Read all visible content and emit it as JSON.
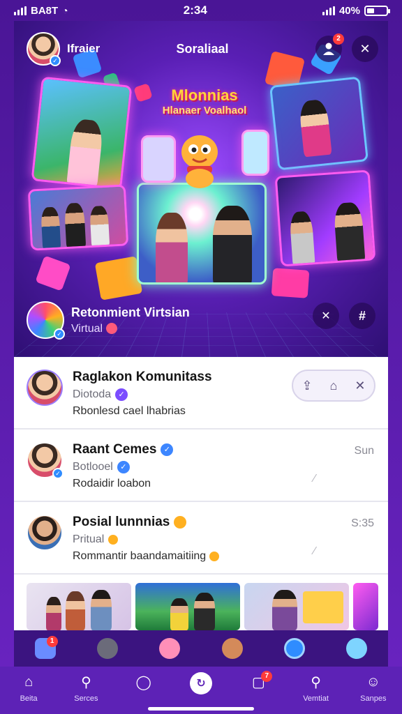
{
  "status_bar": {
    "carrier": "BA8T",
    "time": "2:34",
    "battery": "40%"
  },
  "hero": {
    "user_name": "Ifraier",
    "title": "Soraliaal",
    "neon_title_line1": "Mlonnias",
    "neon_title_line2": "Hlanaer Voalhaol",
    "notification_count": "2",
    "featured": {
      "title": "Retonmient Virtsian",
      "subtitle": "Virtual"
    }
  },
  "feed": {
    "items": [
      {
        "title": "Raglakon Komunitass",
        "subtitle": "Diotoda",
        "description": "Rbonlesd cael lhabrias",
        "meta": ""
      },
      {
        "title": "Raant Cemes",
        "subtitle": "Botlooel",
        "description": "Rodaidir loabon",
        "meta": "Sun"
      },
      {
        "title": "Posial lunnnias",
        "subtitle": "Pritual",
        "description": "Rommantir baandamaitiing",
        "meta": "S:35"
      }
    ]
  },
  "tabs": [
    {
      "label": "Beita",
      "icon": "home-icon"
    },
    {
      "label": "Serces",
      "icon": "search-icon"
    },
    {
      "label": "",
      "icon": "chat-icon"
    },
    {
      "label": "",
      "icon": "create-icon"
    },
    {
      "label": "",
      "icon": "message-icon"
    },
    {
      "label": "Vemtiat",
      "icon": "search-icon"
    },
    {
      "label": "Sanpes",
      "icon": "profile-icon"
    }
  ],
  "strip_badges": {
    "music": "1",
    "messages": "7"
  },
  "colors": {
    "primary": "#5d22b6",
    "accent": "#ff5cf0",
    "verified": "#3d86ff"
  }
}
